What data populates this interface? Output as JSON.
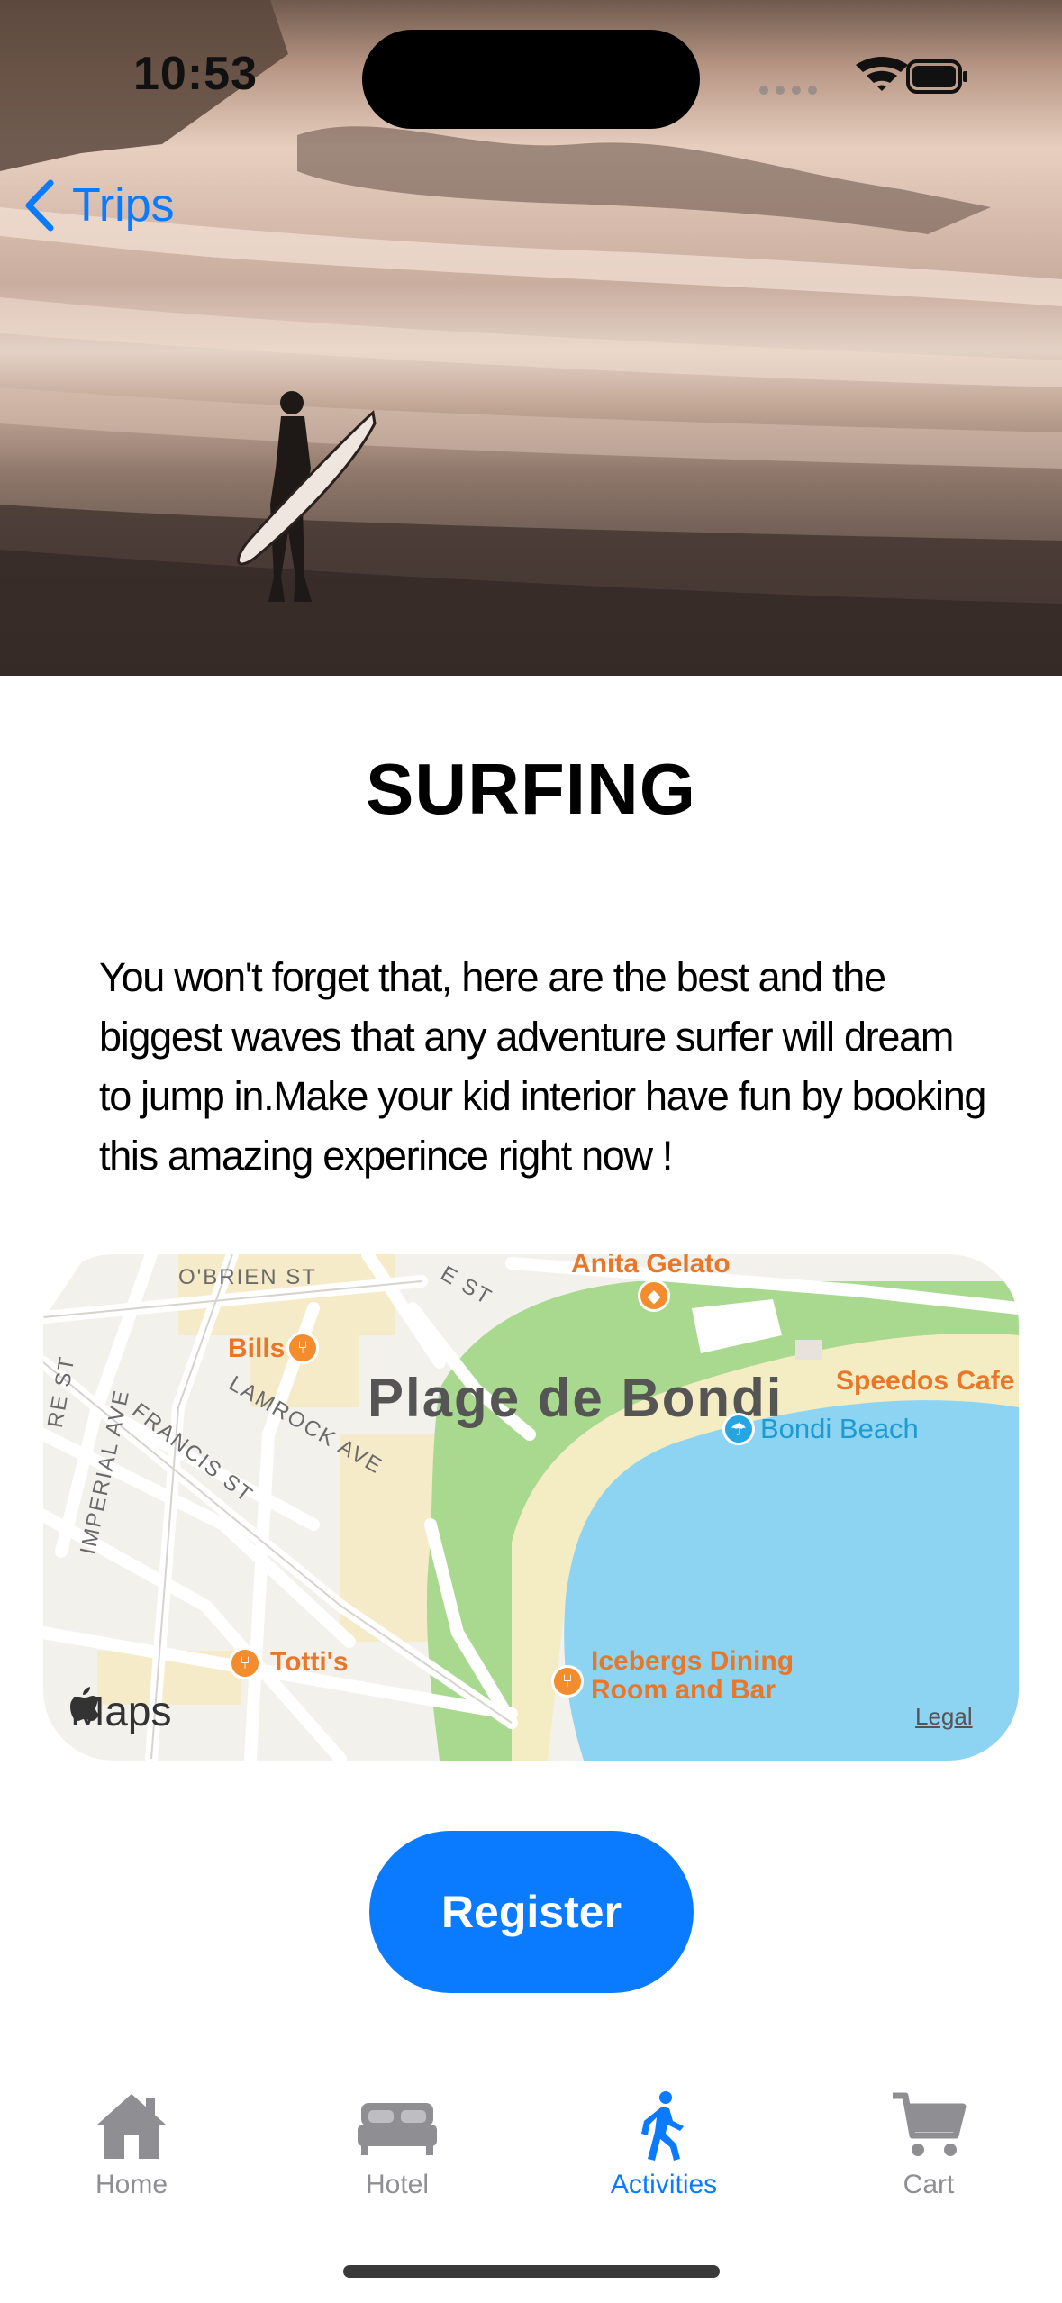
{
  "status": {
    "time": "10:53"
  },
  "nav": {
    "back_label": "Trips"
  },
  "activity": {
    "title": "SURFING",
    "description": "You won't forget that, here are the best and the biggest waves that any adventure surfer will dream to jump in.Make your kid interior have fun by booking this amazing experince right now !"
  },
  "map": {
    "area_name": "Plage de Bondi",
    "streets": [
      "O'BRIEN ST",
      "LAMROCK AVE",
      "FRANCIS ST",
      "IMPERIAL AVE",
      "E ST",
      "RE ST"
    ],
    "pois": [
      "Anita Gelato",
      "Bills",
      "Speedos Cafe",
      "Bondi Beach",
      "Totti's",
      "Icebergs Dining Room and Bar"
    ],
    "brand": "Maps",
    "legal": "Legal"
  },
  "actions": {
    "register_label": "Register"
  },
  "tabs": [
    {
      "label": "Home",
      "icon": "house-icon"
    },
    {
      "label": "Hotel",
      "icon": "bed-icon"
    },
    {
      "label": "Activities",
      "icon": "walking-icon",
      "active": true
    },
    {
      "label": "Cart",
      "icon": "cart-icon"
    }
  ],
  "colors": {
    "accent": "#0a7aff",
    "inactive_tab": "#8e8e93",
    "water": "#8dd3f2",
    "park": "#a9d98f"
  }
}
